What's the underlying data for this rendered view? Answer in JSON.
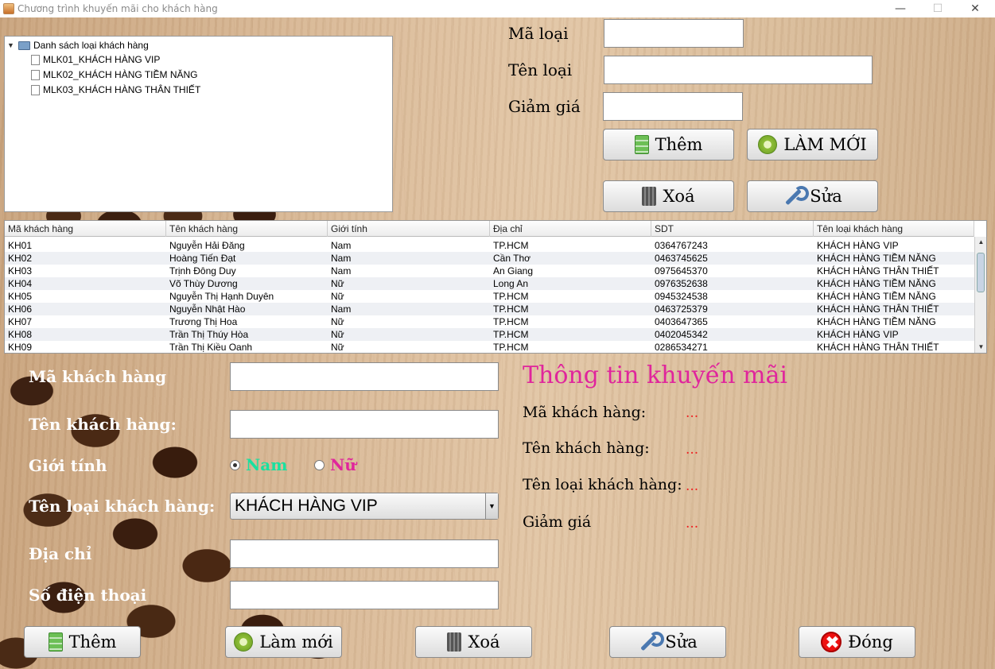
{
  "window": {
    "title": "Chương trình khuyến mãi cho khách hàng",
    "minimize": "—",
    "maximize": "☐",
    "close": "✕"
  },
  "tree": {
    "toggle": "▼",
    "root": "Danh sách loại khách hàng",
    "items": [
      "MLK01_KHÁCH HÀNG VIP",
      "MLK02_KHÁCH HÀNG TIỀM NĂNG",
      "MLK03_KHÁCH HÀNG THÂN THIẾT"
    ]
  },
  "category_form": {
    "ma_loai_label": "Mã loại",
    "ten_loai_label": "Tên loại",
    "giam_gia_label": "Giảm giá",
    "them_label": "Thêm",
    "lam_moi_label": "LÀM MỚI",
    "xoa_label": "Xoá",
    "sua_label": "Sửa"
  },
  "table": {
    "columns": [
      "Mã khách hàng",
      "Tên khách hàng",
      "Giới tính",
      "Địa chỉ",
      "SDT",
      "Tên loại khách hàng"
    ],
    "rows": [
      [
        "KH01",
        "Nguyễn Hải Đăng",
        "Nam",
        "TP.HCM",
        "0364767243",
        "KHÁCH HÀNG VIP"
      ],
      [
        "KH02",
        "Hoàng Tiến Đạt",
        "Nam",
        "Cần Thơ",
        "0463745625",
        "KHÁCH HÀNG TIỀM NĂNG"
      ],
      [
        "KH03",
        "Trịnh Đông Duy",
        "Nam",
        "An Giang",
        "0975645370",
        "KHÁCH HÀNG THÂN THIẾT"
      ],
      [
        "KH04",
        "Võ Thùy Dương",
        "Nữ",
        "Long An",
        "0976352638",
        "KHÁCH HÀNG TIỀM NĂNG"
      ],
      [
        "KH05",
        "Nguyễn Thị Hạnh Duyên",
        "Nữ",
        "TP.HCM",
        "0945324538",
        "KHÁCH HÀNG TIỀM NĂNG"
      ],
      [
        "KH06",
        "Nguyễn Nhật Hào",
        "Nam",
        "TP.HCM",
        "0463725379",
        "KHÁCH HÀNG THÂN THIẾT"
      ],
      [
        "KH07",
        "Trương Thị Hoa",
        "Nữ",
        "TP.HCM",
        "0403647365",
        "KHÁCH HÀNG TIỀM NĂNG"
      ],
      [
        "KH08",
        "Trần Thị Thúy Hòa",
        "Nữ",
        "TP.HCM",
        "0402045342",
        "KHÁCH HÀNG VIP"
      ],
      [
        "KH09",
        "Trần Thị Kiều Oanh",
        "Nữ",
        "TP.HCM",
        "0286534271",
        "KHÁCH HÀNG THÂN THIẾT"
      ]
    ],
    "scroll_up": "▲",
    "scroll_down": "▼"
  },
  "customer_form": {
    "ma_kh_label": "Mã khách hàng",
    "ten_kh_label": "Tên khách hàng:",
    "gioi_tinh_label": "Giới tính",
    "nam_label": "Nam",
    "nu_label": "Nữ",
    "loai_kh_label": "Tên loại khách hàng:",
    "loai_kh_value": "KHÁCH HÀNG VIP",
    "dropdown_arrow": "▼",
    "dia_chi_label": "Địa chỉ",
    "sdt_label": "Số điện thoại"
  },
  "promo": {
    "title": "Thông tin khuyến mãi",
    "ma_kh_label": "Mã khách hàng:",
    "ten_kh_label": "Tên khách hàng:",
    "ten_loai_label": "Tên loại khách hàng:",
    "giam_gia_label": "Giảm giá",
    "placeholder_value": "..."
  },
  "bottom_buttons": {
    "them": "Thêm",
    "lam_moi": "Làm mới",
    "xoa": "Xoá",
    "sua": "Sửa",
    "dong": "Đóng"
  },
  "colors": {
    "nam_color": "#19e0a0",
    "nu_color": "#e0259c",
    "promo_title_color": "#e0259c",
    "promo_value_color": "#e22222"
  }
}
